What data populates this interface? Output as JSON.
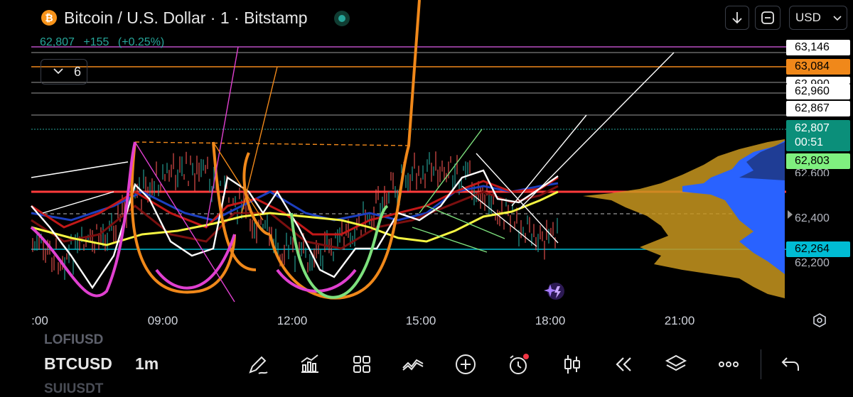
{
  "header": {
    "coin_symbol": "₿",
    "title": "Bitcoin / U.S. Dollar · 1 · Bitstamp",
    "currency": "USD",
    "download_icon": "arrow-down-icon",
    "fullscreen_icon": "fullscreen-icon"
  },
  "quote": {
    "last": "62,807",
    "change": "+155",
    "change_pct": "(+0.25%)"
  },
  "indicators": {
    "collapse_icon": "chevron-down-icon",
    "count": "6"
  },
  "price_labels": {
    "p1": "63,146",
    "p2": "63,084",
    "p3": "62,960",
    "p4": "62,867",
    "p5": "62,807",
    "countdown": "00:51",
    "p6": "62,803",
    "p7": "62,264",
    "hidden_top": "62,990",
    "hidden_62600": "62,600"
  },
  "price_axis": {
    "tick_62400": "62,400",
    "tick_62200": "62,200"
  },
  "time_axis": {
    "t0": ":00",
    "t1": "09:00",
    "t2": "12:00",
    "t3": "15:00",
    "t4": "18:00",
    "t5": "21:00"
  },
  "bottom": {
    "ticker_prev": "LOFIUSD",
    "ticker": "BTCUSD",
    "interval": "1m",
    "ticker_next": "SUIUSDT"
  },
  "toolbar": [
    "pencil-icon",
    "chart-bars-icon",
    "grid-icon",
    "indicator-icon",
    "plus-icon",
    "alarm-clock-icon",
    "candlestick-icon",
    "rewind-icon",
    "layers-icon",
    "more-icon",
    "undo-icon"
  ],
  "colors": {
    "up": "#26a69a",
    "down": "#ef5350",
    "orange": "#f0881a",
    "magenta": "#e040d0",
    "yellow": "#f5f542",
    "red_line": "#ff3b3b",
    "vp_blue": "#2962ff",
    "vp_gold": "#c8961e",
    "cyan_line": "#00bcd4"
  }
}
